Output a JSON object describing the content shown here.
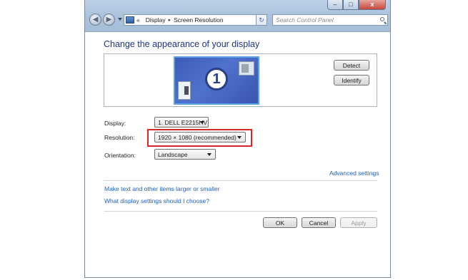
{
  "window": {
    "nav": {
      "back_icon": "back-arrow-icon",
      "forward_icon": "forward-arrow-icon"
    },
    "controls": {
      "minimize": "–",
      "maximize": "□",
      "close": "x"
    },
    "address": {
      "overflow": "«",
      "crumbs": [
        "Display",
        "Screen Resolution"
      ],
      "separator": "▸"
    },
    "search": {
      "placeholder": "Search Control Panel"
    }
  },
  "main": {
    "title": "Change the appearance of your display",
    "monitor_number": "1",
    "detect_button": "Detect",
    "identify_button": "Identify",
    "display": {
      "label": "Display:",
      "value": "1. DELL E2215HV"
    },
    "resolution": {
      "label": "Resolution:",
      "value": "1920 × 1080 (recommended)"
    },
    "orientation": {
      "label": "Orientation:",
      "value": "Landscape"
    },
    "advanced_link": "Advanced settings",
    "link_text_size": "Make text and other items larger or smaller",
    "link_help": "What display settings should I choose?"
  },
  "footer": {
    "ok": "OK",
    "cancel": "Cancel",
    "apply": "Apply"
  },
  "colors": {
    "title": "#1e3287",
    "link": "#1b5fbf",
    "highlight": "#d62828",
    "monitor": "#3b5bb8"
  }
}
